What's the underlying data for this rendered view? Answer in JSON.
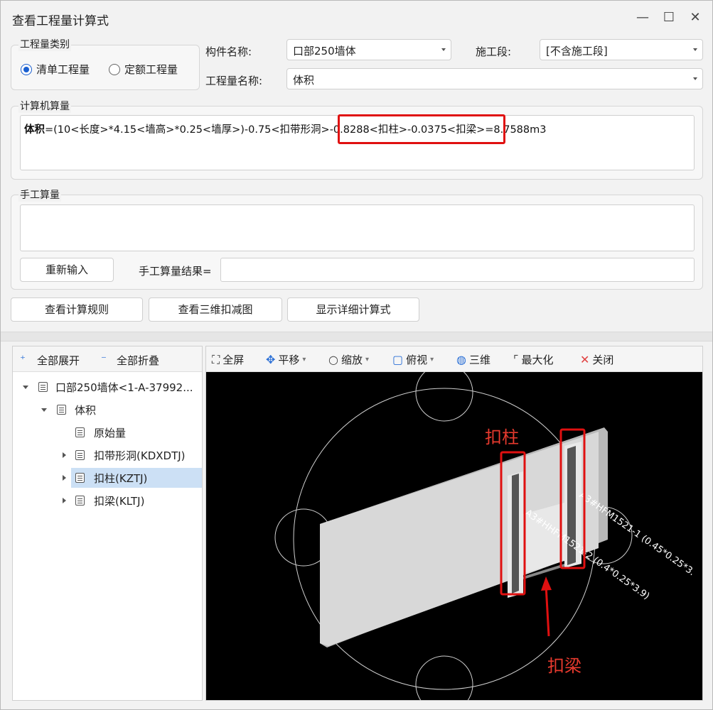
{
  "window": {
    "title": "查看工程量计算式",
    "minimize": "—",
    "maximize": "☐",
    "close": "✕"
  },
  "quantity_type": {
    "legend": "工程量类别",
    "options": [
      {
        "label": "清单工程量",
        "selected": true
      },
      {
        "label": "定额工程量",
        "selected": false
      }
    ]
  },
  "component": {
    "label": "构件名称:",
    "value": "口部250墙体"
  },
  "stage": {
    "label": "施工段:",
    "value": "[不含施工段]"
  },
  "quantity_name": {
    "label": "工程量名称:",
    "value": "体积"
  },
  "computer": {
    "legend": "计算机算量",
    "formula_name": "体积",
    "formula_rest": "=(10<长度>*4.15<墙高>*0.25<墙厚>)-0.75<扣带形洞>-0.8288<扣柱>-0.0375<扣梁>=8.7588m3"
  },
  "manual": {
    "legend": "手工算量",
    "reenter_button": "重新输入",
    "result_label": "手工算量结果=",
    "result_value": ""
  },
  "buttons": {
    "view_rules": "查看计算规则",
    "view_3d": "查看三维扣减图",
    "show_detail": "显示详细计算式"
  },
  "tree_toolbar": {
    "expand_all": "全部展开",
    "collapse_all": "全部折叠"
  },
  "tree": [
    {
      "label": "口部250墙体<1-A-37992...",
      "level": 0,
      "expanded": true
    },
    {
      "label": "体积",
      "level": 1,
      "expanded": true
    },
    {
      "label": "原始量",
      "level": 2,
      "leaf": true
    },
    {
      "label": "扣带形洞(KDXDTJ)",
      "level": 2
    },
    {
      "label": "扣柱(KZTJ)",
      "level": 2,
      "selected": true
    },
    {
      "label": "扣梁(KLTJ)",
      "level": 2
    }
  ],
  "view_toolbar": {
    "fullscreen": "全屏",
    "pan": "平移",
    "zoom": "缩放",
    "top_view": "俯视",
    "three_d": "三维",
    "maximize": "最大化",
    "close": "关闭"
  },
  "viewport": {
    "label_1": "A3#HFM1521-1 (0.45*0.25*3.",
    "label_2": "A3#HHFM1521-2 (0.4*0.25*3.9)"
  },
  "annotations": {
    "column": "扣柱",
    "beam": "扣梁"
  },
  "colors": {
    "accent": "#1a5fd0",
    "highlight": "#e01010",
    "selection": "#cce0f5"
  }
}
